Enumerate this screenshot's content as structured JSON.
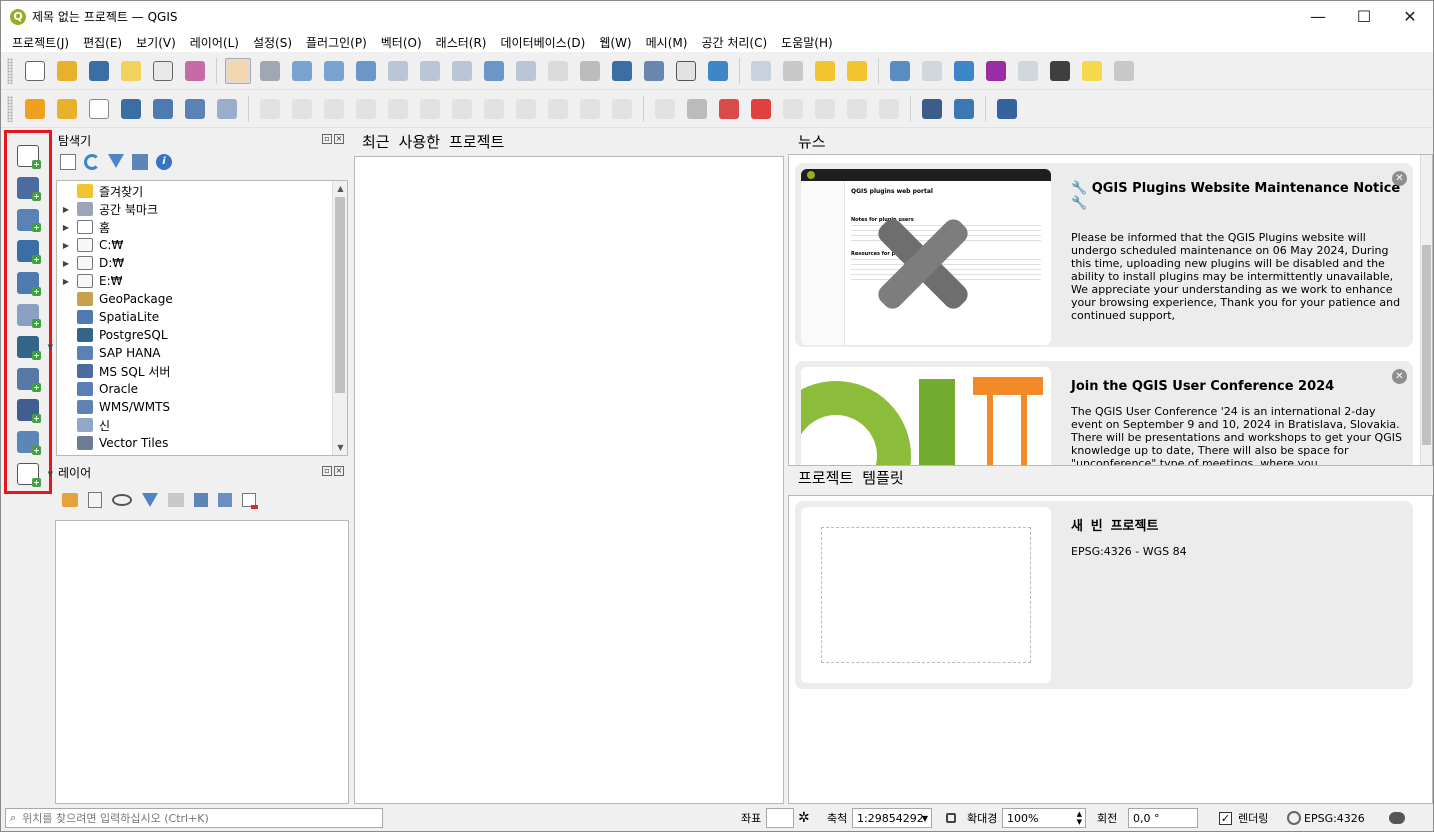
{
  "window": {
    "title": "제목 없는 프로젝트 — QGIS",
    "logo": "Q",
    "min": "—",
    "max": "☐",
    "close": "✕"
  },
  "menus": [
    "프로젝트(J)",
    "편집(E)",
    "보기(V)",
    "레이어(L)",
    "설정(S)",
    "플러그인(P)",
    "벡터(O)",
    "래스터(R)",
    "데이터베이스(D)",
    "웹(W)",
    "메시(M)",
    "공간 처리(C)",
    "도움말(H)"
  ],
  "toolbar1": [
    {
      "name": "new-project-icon",
      "color": "#ffffff",
      "border": "#666"
    },
    {
      "name": "open-project-icon",
      "color": "#e8b12c"
    },
    {
      "name": "save-project-icon",
      "color": "#3a6ea5"
    },
    {
      "name": "new-print-layout-icon",
      "color": "#f2d25c"
    },
    {
      "name": "layout-manager-icon",
      "color": "#e9e9e9",
      "border": "#666"
    },
    {
      "name": "style-manager-icon",
      "color": "#c76aa8"
    },
    {
      "sep": true
    },
    {
      "name": "pan-map-icon",
      "color": "#f3d7b1",
      "active": true
    },
    {
      "name": "pan-to-selection-icon",
      "color": "#9fa7b3"
    },
    {
      "name": "zoom-in-icon",
      "color": "#7aa3d1"
    },
    {
      "name": "zoom-out-icon",
      "color": "#7aa3d1"
    },
    {
      "name": "zoom-full-icon",
      "color": "#6c96c8"
    },
    {
      "name": "zoom-to-selection-icon",
      "color": "#b8c6d8"
    },
    {
      "name": "zoom-to-layer-icon",
      "color": "#b8c6d8"
    },
    {
      "name": "zoom-native-icon",
      "color": "#b8c6d8"
    },
    {
      "name": "zoom-last-icon",
      "color": "#6c96c8"
    },
    {
      "name": "zoom-next-icon",
      "color": "#b8c6d8"
    },
    {
      "name": "new-map-view-icon",
      "color": "#dadada"
    },
    {
      "name": "new-3d-map-view-icon",
      "color": "#bcbcbc"
    },
    {
      "name": "new-bookmark-icon",
      "color": "#3a6ea5"
    },
    {
      "name": "show-bookmarks-icon",
      "color": "#6a86b0"
    },
    {
      "name": "temporal-controller-icon",
      "color": "#e2e2e2",
      "border": "#555"
    },
    {
      "name": "refresh-icon",
      "color": "#3c86c9"
    },
    {
      "sep": true
    },
    {
      "name": "select-features-icon",
      "color": "#c8d2dc"
    },
    {
      "name": "deselect-icon",
      "color": "#c8c8c8"
    },
    {
      "name": "deselect-layer-icon",
      "color": "#f4c430"
    },
    {
      "name": "select-by-location-icon",
      "color": "#f4c430"
    },
    {
      "sep": true
    },
    {
      "name": "identify-icon",
      "color": "#5b8bc4"
    },
    {
      "name": "attribute-table-icon",
      "color": "#cfd6de"
    },
    {
      "name": "processing-toolbox-icon",
      "color": "#3c86c9"
    },
    {
      "name": "statistics-sum-icon",
      "color": "#9a2ca5"
    },
    {
      "name": "open-field-calc-icon",
      "color": "#cfd6de"
    },
    {
      "name": "measure-line-icon",
      "color": "#3f3f3f"
    },
    {
      "name": "map-tips-icon",
      "color": "#f4d84e"
    },
    {
      "name": "locator-filter-icon",
      "color": "#c8c8c8"
    }
  ],
  "toolbar2": [
    {
      "name": "data-source-manager-icon",
      "color": "#f0a020"
    },
    {
      "name": "add-layer-db-icon",
      "color": "#e8b12c"
    },
    {
      "name": "new-shapefile-icon",
      "color": "#ffffff",
      "border": "#888"
    },
    {
      "name": "digitize-feature-icon",
      "color": "#3a6ea5"
    },
    {
      "name": "new-spatialite-icon",
      "color": "#4d7ab0"
    },
    {
      "name": "new-virtual-layer-icon",
      "color": "#5b82b6"
    },
    {
      "name": "new-temp-scratch-icon",
      "color": "#9aaecb"
    },
    {
      "sep": true
    },
    {
      "name": "toggle-editing-icon",
      "color": "#c8c8c8",
      "dis": true
    },
    {
      "name": "current-edits-icon",
      "color": "#c8c8c8",
      "dis": true
    },
    {
      "name": "save-edits-icon",
      "color": "#c8c8c8",
      "dis": true
    },
    {
      "name": "add-line-feature-icon",
      "color": "#c8c8c8",
      "dis": true
    },
    {
      "name": "vertex-tool-icon",
      "color": "#c8c8c8",
      "dis": true
    },
    {
      "name": "modify-attributes-icon",
      "color": "#c8c8c8",
      "dis": true
    },
    {
      "name": "delete-selected-icon",
      "color": "#c8c8c8",
      "dis": true
    },
    {
      "name": "cut-features-icon",
      "color": "#c8c8c8",
      "dis": true
    },
    {
      "name": "copy-features-icon",
      "color": "#c8c8c8",
      "dis": true
    },
    {
      "name": "paste-features-icon",
      "color": "#c8c8c8",
      "dis": true
    },
    {
      "name": "undo-icon",
      "color": "#c8c8c8",
      "dis": true
    },
    {
      "name": "redo-icon",
      "color": "#c8c8c8",
      "dis": true
    },
    {
      "sep": true
    },
    {
      "name": "label-tool-icon",
      "color": "#c8c8c8",
      "dis": true
    },
    {
      "name": "pin-labels-icon",
      "color": "#bbbbbb"
    },
    {
      "name": "highlight-pinned-labels-icon",
      "color": "#d94b4b"
    },
    {
      "name": "rotate-label-icon",
      "color": "#e04040"
    },
    {
      "name": "show-hide-labels-icon",
      "color": "#c8c8c8",
      "dis": true
    },
    {
      "name": "move-label-icon",
      "color": "#c8c8c8",
      "dis": true
    },
    {
      "name": "rotate-label-2-icon",
      "color": "#c8c8c8",
      "dis": true
    },
    {
      "name": "change-label-icon",
      "color": "#c8c8c8",
      "dis": true
    },
    {
      "sep": true
    },
    {
      "name": "gps-plugin-icon",
      "color": "#3c5c8a"
    },
    {
      "name": "python-console-icon",
      "color": "#3c78b4"
    },
    {
      "sep": true
    },
    {
      "name": "help-icon",
      "color": "#3463a0"
    }
  ],
  "left_toolbar": [
    {
      "name": "add-vector-layer-icon",
      "color": "#ffffff",
      "dd": false
    },
    {
      "name": "add-raster-layer-icon",
      "color": "#4c6ca0",
      "dd": false
    },
    {
      "name": "add-mesh-layer-icon",
      "color": "#5b82b6",
      "dd": false
    },
    {
      "name": "add-delimited-text-icon",
      "color": "#3a6ea5",
      "dd": false
    },
    {
      "name": "add-gpx-layer-icon",
      "color": "#4d7ab0",
      "dd": false
    },
    {
      "name": "add-spatialite-layer-icon",
      "color": "#8aa0c2",
      "dd": false
    },
    {
      "name": "add-postgis-layer-icon",
      "color": "#33658a",
      "dd": true
    },
    {
      "name": "add-wms-layer-icon",
      "color": "#5779a8",
      "dd": false
    },
    {
      "name": "add-wfs-layer-icon",
      "color": "#415f8e",
      "dd": false
    },
    {
      "name": "add-wcs-layer-icon",
      "color": "#5c85b8",
      "dd": false
    },
    {
      "name": "add-virtual-layer-icon",
      "color": "#ffffff",
      "dd": true
    }
  ],
  "browser": {
    "title": "탐색기",
    "items": [
      {
        "label": "즐겨찾기",
        "arrow": "",
        "icon": "#f4c430"
      },
      {
        "label": "공간 북마크",
        "arrow": "▶",
        "icon": "#9aa6b8"
      },
      {
        "label": "홈",
        "arrow": "▶",
        "icon": "#ffffff"
      },
      {
        "label": "C:₩",
        "arrow": "▶",
        "icon": "#f7f7f7"
      },
      {
        "label": "D:₩",
        "arrow": "▶",
        "icon": "#f7f7f7"
      },
      {
        "label": "E:₩",
        "arrow": "▶",
        "icon": "#f7f7f7"
      },
      {
        "label": "GeoPackage",
        "arrow": "",
        "icon": "#c9a14a"
      },
      {
        "label": "SpatiaLite",
        "arrow": "",
        "icon": "#4d7ab0"
      },
      {
        "label": "PostgreSQL",
        "arrow": "",
        "icon": "#33658a"
      },
      {
        "label": "SAP HANA",
        "arrow": "",
        "icon": "#5b82b6"
      },
      {
        "label": "MS SQL 서버",
        "arrow": "",
        "icon": "#4c6ca0"
      },
      {
        "label": "Oracle",
        "arrow": "",
        "icon": "#5a7fb5"
      },
      {
        "label": "WMS/WMTS",
        "arrow": "",
        "icon": "#6083b6"
      },
      {
        "label": "신",
        "arrow": "",
        "icon": "#8fa8c8"
      },
      {
        "label": "Vector Tiles",
        "arrow": "",
        "icon": "#6b7c94"
      }
    ]
  },
  "layers": {
    "title": "레이어"
  },
  "recent": {
    "title": "최근 사용한 프로젝트"
  },
  "news": {
    "title": "뉴스",
    "items": [
      {
        "title": "🔧 QGIS Plugins Website Maintenance Notice 🔧",
        "body": "Please be informed that the QGIS Plugins website will undergo scheduled maintenance on 06 May 2024, During this time, uploading new plugins will be disabled and the ability to install plugins may be intermittently unavailable, We appreciate your understanding as we work to enhance your browsing experience, Thank you for your patience and continued support,",
        "image_caption": "QGIS plugins web portal",
        "image_sub1": "Notes for plugin users",
        "image_sub2": "Resources for plugin authors"
      },
      {
        "title": "Join the QGIS User Conference 2024",
        "body": "The QGIS User Conference '24 is an international 2-day event on September 9 and 10, 2024 in Bratislava, Slovakia. There will be presentations and workshops to get your QGIS knowledge up to date, There will also be space for \"unconference\" type of meetings, where you"
      }
    ]
  },
  "templates": {
    "title": "프로젝트 템플릿",
    "items": [
      {
        "title": "새 빈 프로젝트",
        "crs": "EPSG:4326 - WGS 84"
      }
    ]
  },
  "status": {
    "locator_placeholder": "위치를 찾으려면 입력하십시오 (Ctrl+K)",
    "coord_label": "좌표",
    "scale_label": "축척",
    "scale_value": "1:29854292",
    "magnifier_label": "확대경",
    "magnifier_value": "100%",
    "rotation_label": "회전",
    "rotation_value": "0,0 °",
    "render_label": "렌더링",
    "crs": "EPSG:4326"
  }
}
